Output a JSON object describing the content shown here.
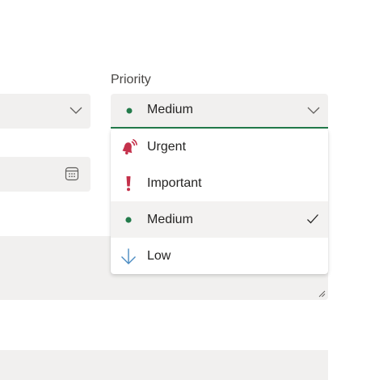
{
  "priority": {
    "label": "Priority",
    "selected_value": "Medium",
    "options": [
      {
        "label": "Urgent",
        "icon": "urgent-bell-icon",
        "color": "#c4314b"
      },
      {
        "label": "Important",
        "icon": "exclamation-icon",
        "color": "#c4314b"
      },
      {
        "label": "Medium",
        "icon": "medium-dot-icon",
        "color": "#237b4b",
        "selected": true
      },
      {
        "label": "Low",
        "icon": "arrow-down-icon",
        "color": "#4a8bc2"
      }
    ]
  },
  "colors": {
    "accent": "#237b4b",
    "field_background": "#f1f0ef",
    "urgent": "#c4314b",
    "low": "#4a8bc2"
  }
}
